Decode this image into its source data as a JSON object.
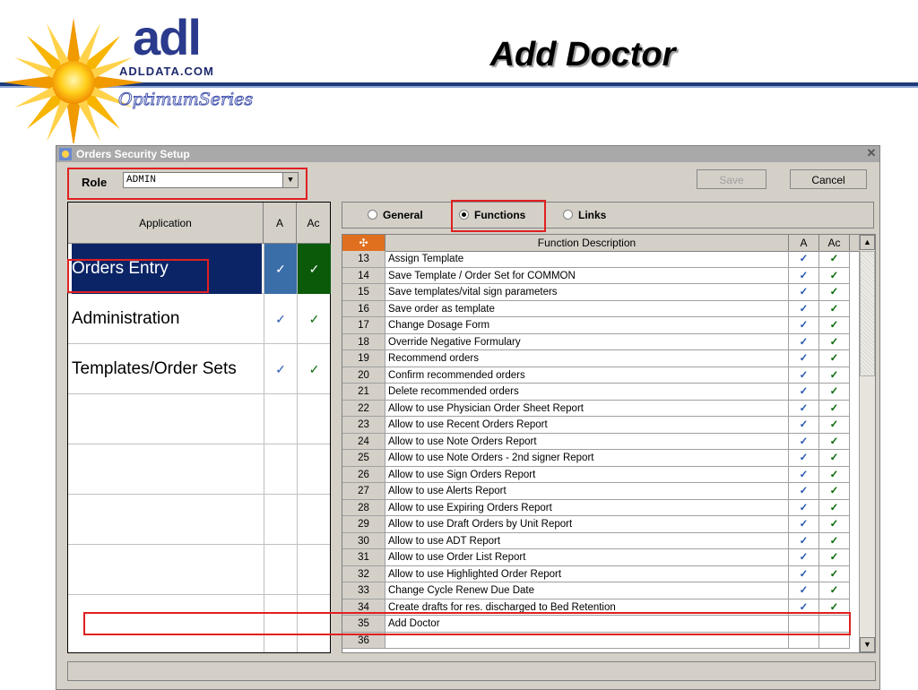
{
  "header": {
    "logo_text": "adl",
    "logo_domain": "ADLDATA.COM",
    "logo_series": "OptimumSeries",
    "page_title": "Add Doctor"
  },
  "window": {
    "title": "Orders Security Setup",
    "close_glyph": "✕"
  },
  "role": {
    "label": "Role",
    "value": "ADMIN",
    "arrow": "▼"
  },
  "buttons": {
    "save": "Save",
    "cancel": "Cancel"
  },
  "left_table": {
    "headers": [
      "Application",
      "A",
      "Ac"
    ],
    "rows": [
      {
        "name": "Orders Entry",
        "a": "✓",
        "ac": "✓",
        "selected": true
      },
      {
        "name": "Administration",
        "a": "✓",
        "ac": "✓",
        "selected": false
      },
      {
        "name": "Templates/Order Sets",
        "a": "✓",
        "ac": "✓",
        "selected": false
      }
    ]
  },
  "radios": {
    "general": "General",
    "functions": "Functions",
    "links": "Links",
    "selected": "functions"
  },
  "grid": {
    "corner_glyph": "✣",
    "headers": [
      "Function Description",
      "A",
      "Ac"
    ],
    "rows": [
      {
        "n": "13",
        "d": "Assign Template",
        "a": "✓",
        "ac": "✓"
      },
      {
        "n": "14",
        "d": "Save Template / Order Set for COMMON",
        "a": "✓",
        "ac": "✓"
      },
      {
        "n": "15",
        "d": "Save templates/vital sign parameters",
        "a": "✓",
        "ac": "✓"
      },
      {
        "n": "16",
        "d": "Save order as template",
        "a": "✓",
        "ac": "✓"
      },
      {
        "n": "17",
        "d": "Change Dosage Form",
        "a": "✓",
        "ac": "✓"
      },
      {
        "n": "18",
        "d": "Override Negative Formulary",
        "a": "✓",
        "ac": "✓"
      },
      {
        "n": "19",
        "d": "Recommend orders",
        "a": "✓",
        "ac": "✓"
      },
      {
        "n": "20",
        "d": "Confirm recommended orders",
        "a": "✓",
        "ac": "✓"
      },
      {
        "n": "21",
        "d": "Delete recommended orders",
        "a": "✓",
        "ac": "✓"
      },
      {
        "n": "22",
        "d": "Allow to use Physician Order Sheet Report",
        "a": "✓",
        "ac": "✓"
      },
      {
        "n": "23",
        "d": "Allow to use Recent Orders Report",
        "a": "✓",
        "ac": "✓"
      },
      {
        "n": "24",
        "d": "Allow to use Note Orders Report",
        "a": "✓",
        "ac": "✓"
      },
      {
        "n": "25",
        "d": "Allow to use Note Orders - 2nd signer Report",
        "a": "✓",
        "ac": "✓"
      },
      {
        "n": "26",
        "d": "Allow to use Sign Orders Report",
        "a": "✓",
        "ac": "✓"
      },
      {
        "n": "27",
        "d": "Allow to use Alerts Report",
        "a": "✓",
        "ac": "✓"
      },
      {
        "n": "28",
        "d": "Allow to use Expiring Orders Report",
        "a": "✓",
        "ac": "✓"
      },
      {
        "n": "29",
        "d": "Allow to use Draft Orders by Unit Report",
        "a": "✓",
        "ac": "✓"
      },
      {
        "n": "30",
        "d": "Allow to use ADT Report",
        "a": "✓",
        "ac": "✓"
      },
      {
        "n": "31",
        "d": "Allow to use Order List Report",
        "a": "✓",
        "ac": "✓"
      },
      {
        "n": "32",
        "d": "Allow to use Highlighted Order Report",
        "a": "✓",
        "ac": "✓"
      },
      {
        "n": "33",
        "d": "Change Cycle Renew Due Date",
        "a": "✓",
        "ac": "✓"
      },
      {
        "n": "34",
        "d": "Create drafts for res. discharged to Bed Retention",
        "a": "✓",
        "ac": "✓"
      },
      {
        "n": "35",
        "d": "Add Doctor",
        "a": "",
        "ac": ""
      },
      {
        "n": "36",
        "d": "",
        "a": "",
        "ac": ""
      }
    ]
  },
  "scrollbar": {
    "up": "▲",
    "down": "▼"
  },
  "colors": {
    "selection_bg": "#0b2466",
    "highlight_red": "#e02020",
    "check_blue": "#2a5ab0",
    "check_green": "#0a6a0a",
    "corner_orange": "#e07020"
  }
}
